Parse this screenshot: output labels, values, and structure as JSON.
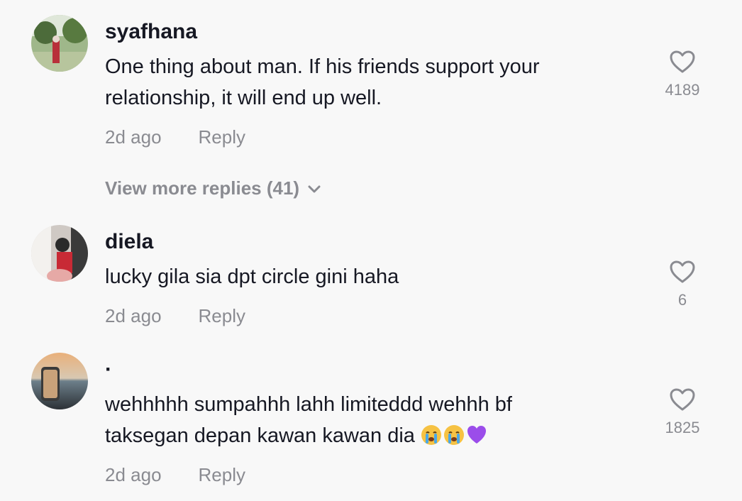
{
  "comments": [
    {
      "username": "syafhana",
      "text_lines": [
        "One thing about man. If his friends support your",
        "relationship, it will end up well."
      ],
      "time": "2d ago",
      "reply_label": "Reply",
      "likes": "4189",
      "view_more": "View more replies (41)"
    },
    {
      "username": "diela",
      "text_lines": [
        "lucky gila sia dpt circle gini haha"
      ],
      "time": "2d ago",
      "reply_label": "Reply",
      "likes": "6"
    },
    {
      "username": "·",
      "text_lines": [
        "wehhhhh sumpahhh lahh limiteddd wehhh bf",
        "taksegan depan kawan kawan dia"
      ],
      "emoji": [
        "crying-face",
        "crying-face",
        "purple-heart"
      ],
      "time": "2d ago",
      "reply_label": "Reply",
      "likes": "1825"
    }
  ],
  "colors": {
    "background": "#f8f8f8",
    "primary_text": "#161823",
    "secondary_text": "#8a8b91",
    "icon": "#8a8b91",
    "purple_heart": "#9b4dea",
    "emoji_face": "#f6c243",
    "tear": "#4aa8e8"
  },
  "icons": {
    "like": "heart-outline-icon",
    "expand": "chevron-down-icon"
  }
}
